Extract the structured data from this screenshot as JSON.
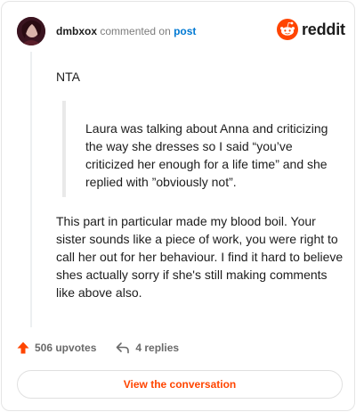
{
  "header": {
    "username": "dmbxox",
    "commented_text": "commented on",
    "post_link": "post"
  },
  "logo": {
    "text": "reddit",
    "icon": "reddit-snoo-icon",
    "brand_color": "#ff4500"
  },
  "comment": {
    "first_line": "NTA",
    "quote": "Laura was talking about Anna and criticizing the way she dresses so I said “you’ve criticized her enough for a life time” and she replied with ”obviously not”.",
    "body": "This part in particular made my blood boil. Your sister sounds like a piece of work, you were right to call her out for her behaviour. I find it hard to believe shes actually sorry if she's still making comments like above also."
  },
  "actions": {
    "upvotes_label": "506 upvotes",
    "upvote_icon": "upvote-arrow-icon",
    "replies_label": "4 replies",
    "reply_icon": "reply-arrow-icon"
  },
  "cta": {
    "label": "View the conversation"
  }
}
